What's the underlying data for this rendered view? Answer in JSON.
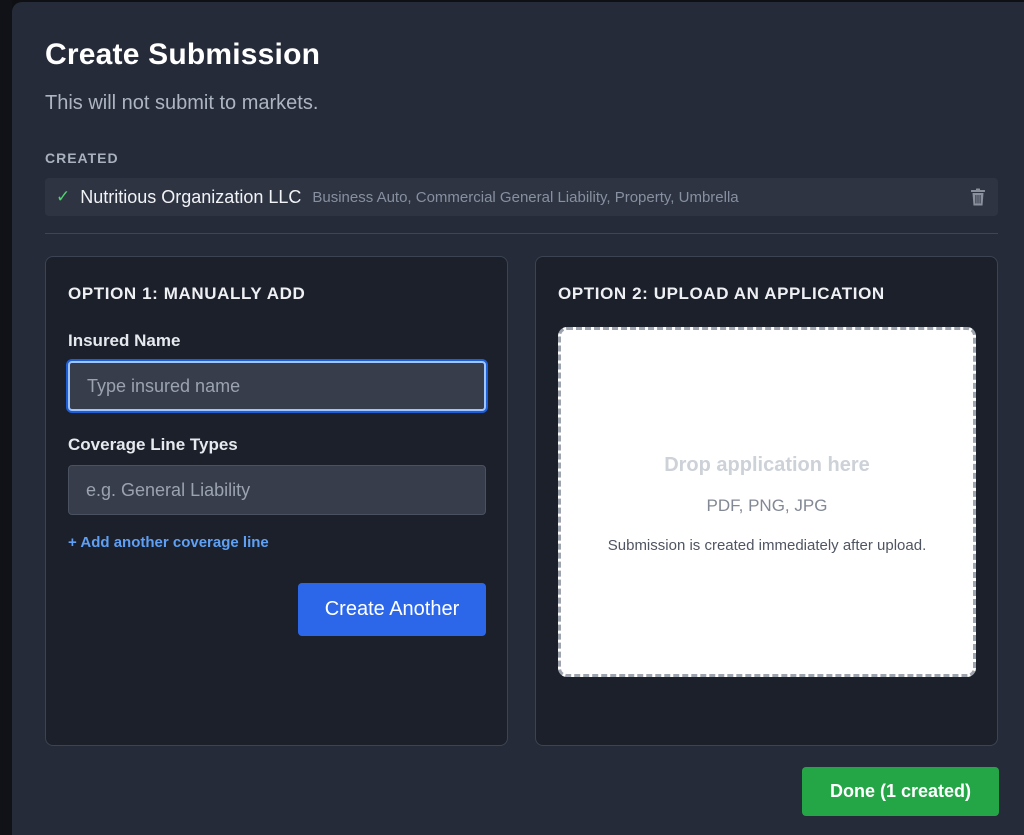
{
  "modal": {
    "title": "Create Submission",
    "subtitle": "This will not submit to markets."
  },
  "created": {
    "section_label": "CREATED",
    "items": [
      {
        "status_icon": "check-icon",
        "insured_name": "Nutritious Organization LLC",
        "coverage_lines": "Business Auto, Commercial General Liability, Property, Umbrella",
        "action_icon": "trash-icon"
      }
    ]
  },
  "option1": {
    "title": "OPTION 1: MANUALLY ADD",
    "insured_name_label": "Insured Name",
    "insured_name_value": "",
    "insured_name_placeholder": "Type insured name",
    "coverage_label": "Coverage Line Types",
    "coverage_value": "",
    "coverage_placeholder": "e.g. General Liability",
    "add_line_link": "+ Add another coverage line",
    "create_button": "Create Another"
  },
  "option2": {
    "title": "OPTION 2: UPLOAD AN APPLICATION",
    "drop_title": "Drop application here",
    "drop_formats": "PDF, PNG, JPG",
    "drop_note": "Submission is created immediately after upload."
  },
  "footer": {
    "done_button": "Done (1 created)"
  },
  "colors": {
    "modal_bg": "#252b38",
    "panel_bg": "#1b202a",
    "primary": "#2c67ea",
    "success": "#24a647",
    "link": "#5fa0f5",
    "check": "#4ed46e"
  }
}
